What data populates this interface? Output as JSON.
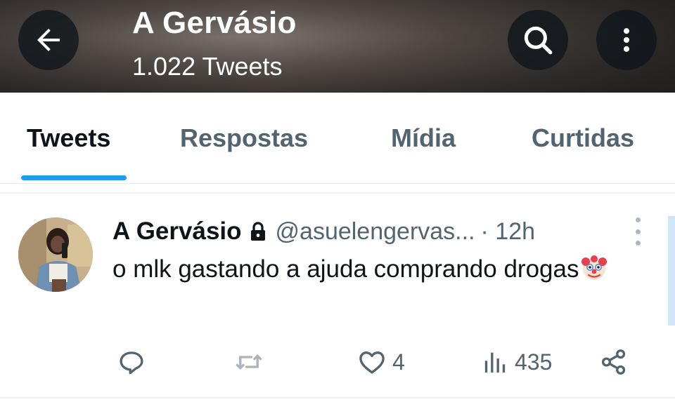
{
  "header": {
    "title": "A Gervásio",
    "tweet_count": "1.022 Tweets",
    "back_icon": "arrow-left-icon",
    "search_icon": "search-icon",
    "more_icon": "more-vertical-icon"
  },
  "tabs": [
    {
      "label": "Tweets",
      "active": true
    },
    {
      "label": "Respostas",
      "active": false
    },
    {
      "label": "Mídia",
      "active": false
    },
    {
      "label": "Curtidas",
      "active": false
    }
  ],
  "tweet": {
    "author_name": "A Gervásio",
    "protected_icon": "lock-icon",
    "handle": "@asuelengervas...",
    "time": "· 12h",
    "text": "o mlk gastando a ajuda comprando drogas",
    "emoji_icon": "clown-face-icon",
    "actions": {
      "reply_count": "",
      "retweet_count": "",
      "like_count": "4",
      "views_count": "435"
    }
  },
  "colors": {
    "accent": "#1d9bf0",
    "text_primary": "#0f1419",
    "text_secondary": "#536471"
  }
}
